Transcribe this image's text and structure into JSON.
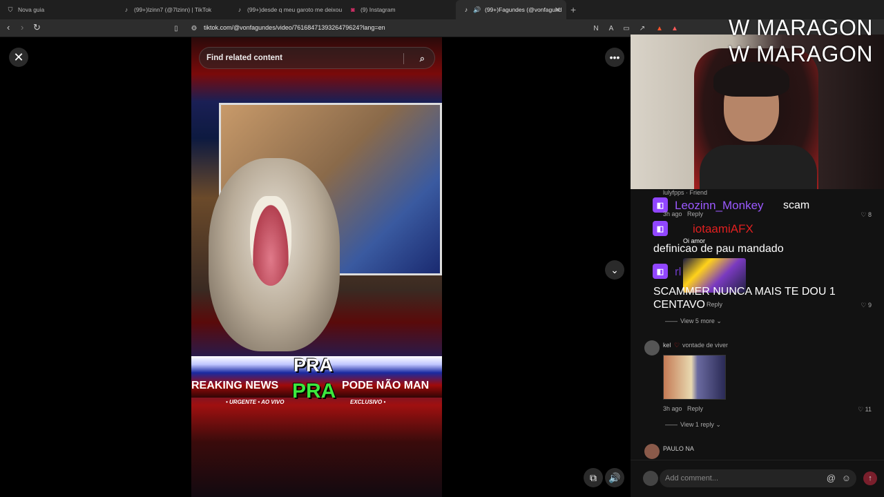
{
  "browser": {
    "tabs": [
      {
        "title": "Nova guia",
        "icon": "shield-icon"
      },
      {
        "title": "(99+)lzinn7 (@7lzinn) | TikTok",
        "icon": "tiktok-icon"
      },
      {
        "title": "(99+)desde q meu garoto me deixou",
        "icon": "tiktok-icon"
      },
      {
        "title": "(9) Instagram",
        "icon": "instagram-icon"
      },
      {
        "title": "(99+)Fagundes (@vonfagund",
        "icon": "tiktok-icon"
      }
    ],
    "url": "tiktok.com/@vonfagundes/video/7616847139326479624?lang=en"
  },
  "video": {
    "search_placeholder": "Find related content",
    "overlay_pra_top": "PRA",
    "overlay_pra_bottom": "PRA",
    "ticker_left": "REAKING NEWS",
    "ticker_right": "PODE NÃO MAN",
    "ticker_sub_left": "• URGENTE • AO VIVO",
    "ticker_sub_right": "EXCLUSIVO •"
  },
  "stream": {
    "watermark_1": "W MARAGON",
    "watermark_2": "W MARAGON"
  },
  "comments": {
    "top_user": "lulyfpps · Friend",
    "chat": [
      {
        "name": "Leozinn_Monkey",
        "message": "scam",
        "color": "#9b59ff"
      },
      {
        "name": "iotaamiAFX",
        "message": "definicao de pau mandado",
        "color": "#e02020"
      },
      {
        "name": "rl",
        "message": "SCAMMER NUNCA MAIS TE DOU 1 CENTAVO",
        "color": "#6a3ac0"
      }
    ],
    "row1_time": "3h ago",
    "row1_reply": "Reply",
    "row1_likes": "8",
    "row2_sub": "Oi amor",
    "row3_reply": "Reply",
    "row3_likes": "9",
    "view_more": "View 5 more",
    "kel_user": "kel",
    "kel_text": "vontade de viver",
    "kel_time": "3h ago",
    "kel_reply": "Reply",
    "kel_likes": "11",
    "view_reply": "View 1 reply",
    "paulo_user": "PAULO NA",
    "add_comment": "Add comment..."
  }
}
